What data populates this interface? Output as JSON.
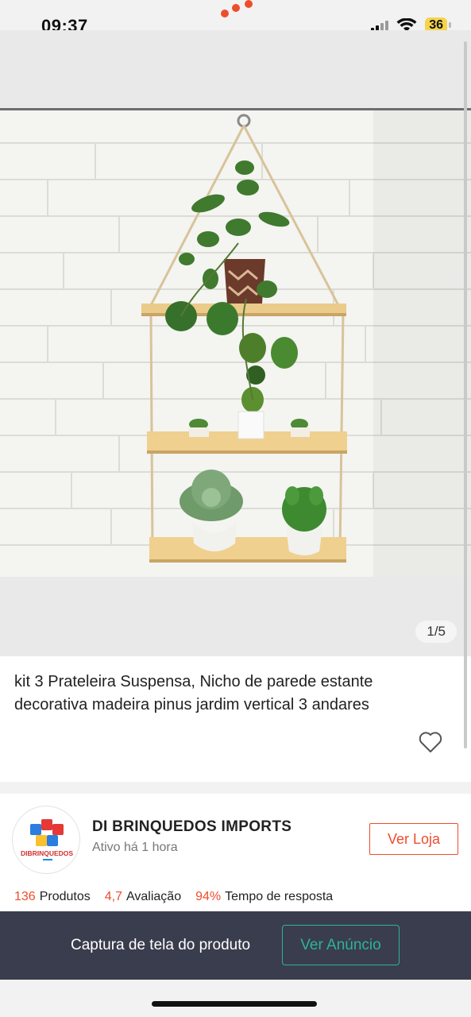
{
  "status_bar": {
    "time": "09:37",
    "battery": "36",
    "icons": [
      "signal-icon",
      "wifi-icon",
      "battery-icon"
    ]
  },
  "gallery": {
    "counter": "1/5"
  },
  "product": {
    "title": "kit 3 Prateleira Suspensa, Nicho de parede estante decorativa madeira pinus jardim vertical 3 andares",
    "favorite_icon": "heart-outline-icon"
  },
  "seller": {
    "name": "DI BRINQUEDOS IMPORTS",
    "active_status": "Ativo há 1 hora",
    "store_button": "Ver Loja",
    "logo_text": "DIBRINQUEDOS",
    "stats": [
      {
        "value": "136",
        "label": "Produtos"
      },
      {
        "value": "4,7",
        "label": "Avaliação"
      },
      {
        "value": "94%",
        "label": "Tempo de resposta"
      }
    ]
  },
  "capture_bar": {
    "text": "Captura de tela do produto",
    "button": "Ver Anúncio"
  },
  "colors": {
    "accent": "#ee4d2d",
    "teal": "#2cb39b",
    "bar_bg": "#3a3d4d"
  }
}
